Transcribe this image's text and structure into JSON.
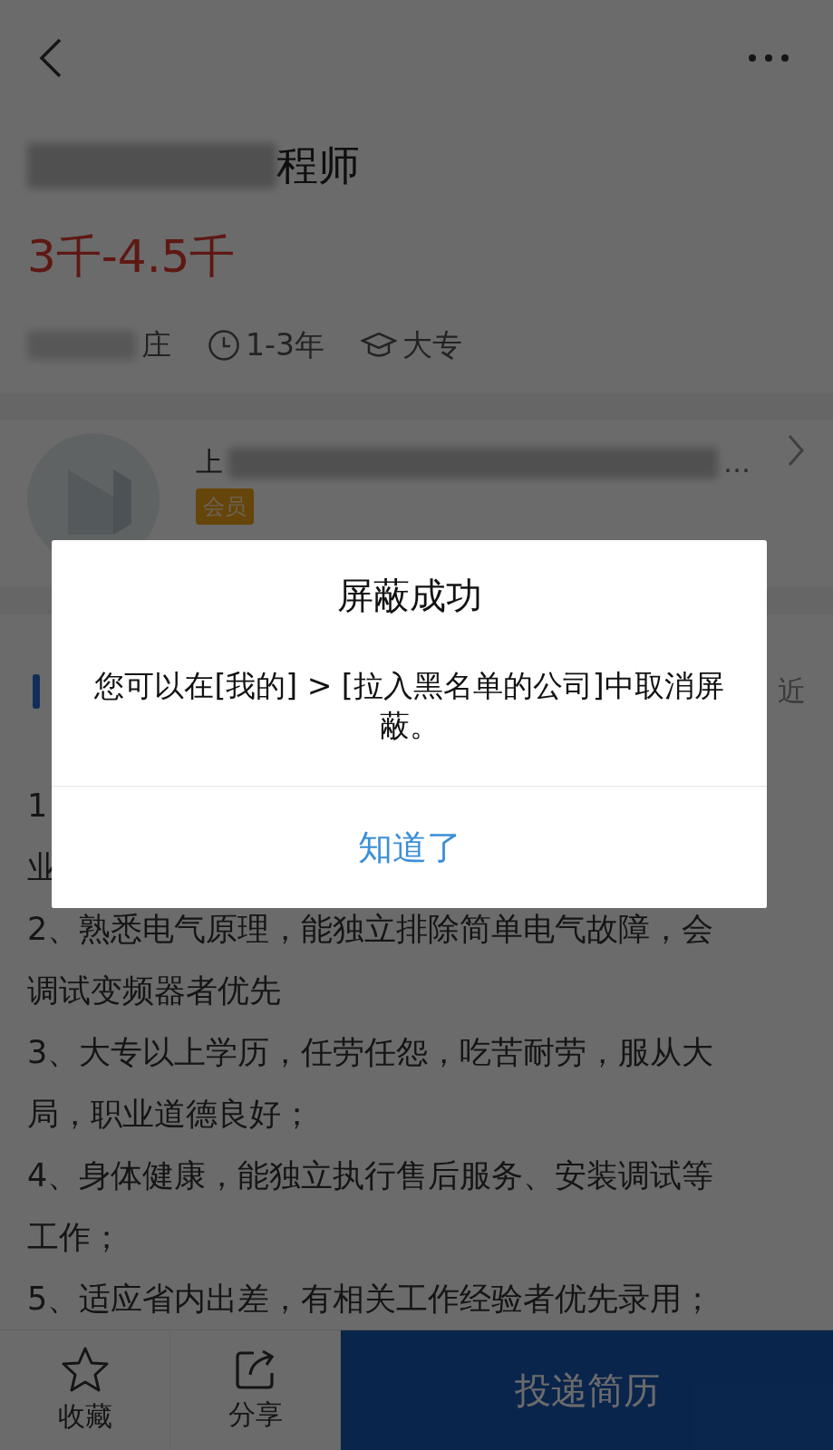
{
  "job": {
    "title_visible": "程师",
    "salary": "3千-4.5千",
    "location_visible": "庄",
    "experience": "1-3年",
    "education": "大专"
  },
  "company": {
    "name_start": "上",
    "name_end": "…",
    "badge": "会员"
  },
  "section": {
    "side_text": "近"
  },
  "description": [
    "1",
    "业",
    "2、熟悉电气原理，能独立排除简单电气故障，会",
    "调试变频器者优先",
    "3、大专以上学历，任劳任怨，吃苦耐劳，服从大",
    "局，职业道德良好；",
    "4、身体健康，能独立执行售后服务、安装调试等",
    "工作；",
    "5、适应省内出差，有相关工作经验者优先录用；"
  ],
  "bottom_bar": {
    "actions": [
      {
        "kind": "star",
        "label": "收藏"
      },
      {
        "kind": "share",
        "label": "分享"
      }
    ],
    "primary": "投递简历"
  },
  "dialog": {
    "title": "屏蔽成功",
    "message": "您可以在[我的] > [拉入黑名单的公司]中取消屏蔽。",
    "button": "知道了"
  }
}
